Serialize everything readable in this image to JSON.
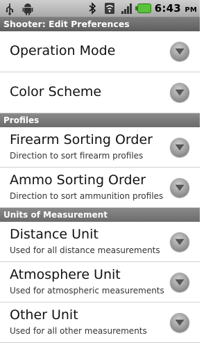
{
  "status_bar": {
    "time": "6:43",
    "ampm": "PM",
    "icons": [
      "usb-icon",
      "android-icon",
      "bluetooth-icon",
      "wifi-icon",
      "signal-icon",
      "battery-icon"
    ]
  },
  "window": {
    "title": "Shooter: Edit Preferences"
  },
  "preferences": {
    "operation_mode": {
      "title": "Operation Mode"
    },
    "color_scheme": {
      "title": "Color Scheme"
    },
    "profiles_header": "Profiles",
    "firearm_sorting": {
      "title": "Firearm Sorting Order",
      "summary": "Direction to sort firearm profiles"
    },
    "ammo_sorting": {
      "title": "Ammo Sorting Order",
      "summary": "Direction to sort ammunition profiles"
    },
    "units_header": "Units of Measurement",
    "distance_unit": {
      "title": "Distance Unit",
      "summary": "Used for all distance measurements"
    },
    "atmosphere_unit": {
      "title": "Atmosphere Unit",
      "summary": "Used for atmospheric measurements"
    },
    "other_unit": {
      "title": "Other Unit",
      "summary": "Used for all other measurements"
    }
  }
}
